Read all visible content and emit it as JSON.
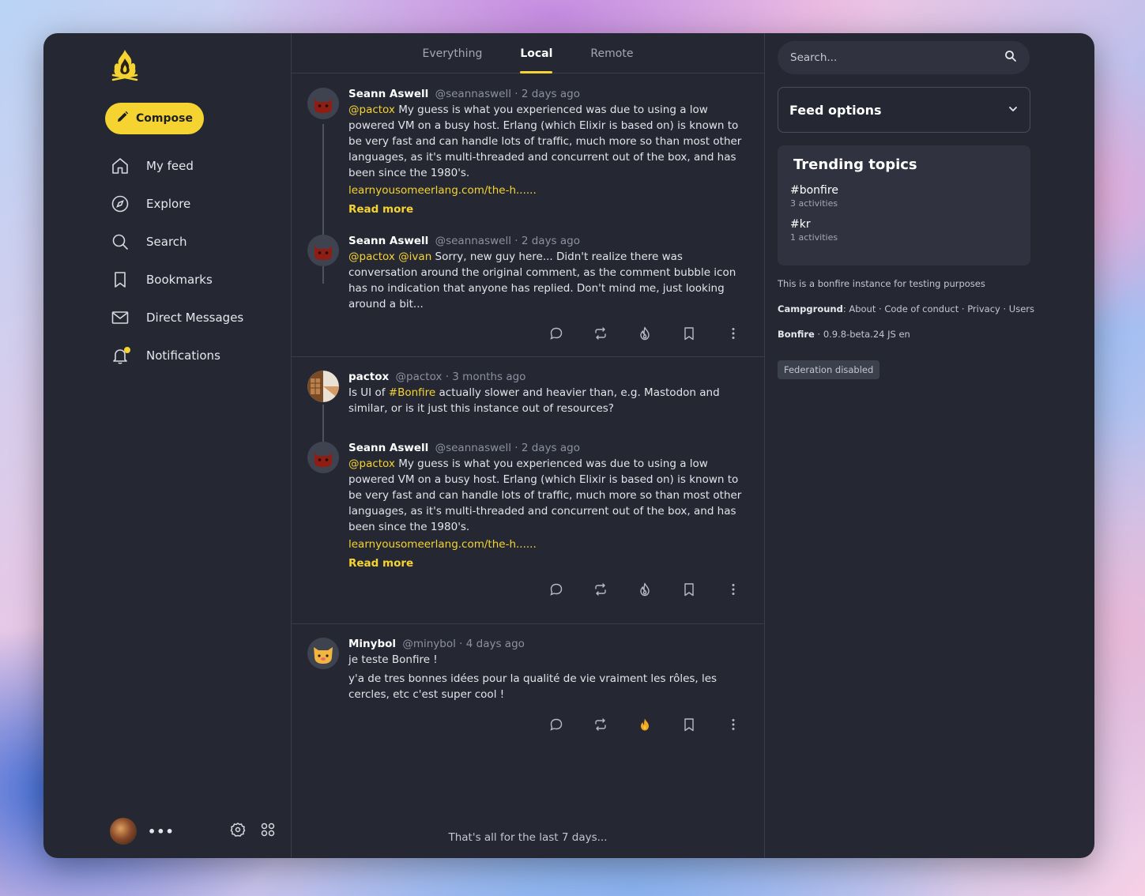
{
  "sidebar": {
    "compose_label": "Compose",
    "nav": [
      {
        "label": "My feed",
        "icon": "home-icon"
      },
      {
        "label": "Explore",
        "icon": "compass-icon"
      },
      {
        "label": "Search",
        "icon": "search-icon"
      },
      {
        "label": "Bookmarks",
        "icon": "bookmark-icon"
      },
      {
        "label": "Direct Messages",
        "icon": "envelope-icon"
      },
      {
        "label": "Notifications",
        "icon": "bell-icon"
      }
    ],
    "more_label": "•••"
  },
  "tabs": [
    {
      "label": "Everything",
      "active": false
    },
    {
      "label": "Local",
      "active": true
    },
    {
      "label": "Remote",
      "active": false
    }
  ],
  "feed": {
    "thread1": {
      "post1": {
        "name": "Seann Aswell",
        "handle": "@seannaswell",
        "time": "· 2 days ago",
        "mention": "@pactox",
        "text": " My guess is what you experienced was due to using a low powered VM on a busy host. Erlang (which Elixir is based on) is known to be very fast and can handle lots of traffic, much more so than most other languages, as it's multi-threaded and concurrent out of the box, and has been since the 1980's.",
        "link": "learnyousomeerlang.com/the-h......",
        "read_more": "Read more"
      },
      "post2": {
        "name": "Seann Aswell",
        "handle": "@seannaswell",
        "time": "· 2 days ago",
        "mention": "@pactox @ivan",
        "text": "  Sorry, new guy here... Didn't realize there was conversation around the original comment, as the comment bubble icon has no indication that anyone has replied. Don't mind me, just looking around a bit..."
      }
    },
    "thread2": {
      "post1": {
        "name": "pactox",
        "handle": "@pactox",
        "time": "· 3 months ago",
        "text_before": "Is UI of ",
        "hashtag": "#Bonfire",
        "text_after": " actually slower and heavier than, e.g. Mastodon and similar, or is it just this instance out of resources?"
      },
      "post2": {
        "name": "Seann Aswell",
        "handle": "@seannaswell",
        "time": "· 2 days ago",
        "mention": "@pactox",
        "text": " My guess is what you experienced was due to using a low powered VM on a busy host. Erlang (which Elixir is based on) is known to be very fast and can handle lots of traffic, much more so than most other languages, as it's multi-threaded and concurrent out of the box, and has been since the 1980's.",
        "link": "learnyousomeerlang.com/the-h......",
        "read_more": "Read more"
      }
    },
    "thread3": {
      "post1": {
        "name": "Minybol",
        "handle": "@minybol",
        "time": "· 4 days ago",
        "line1": "je teste Bonfire !",
        "line2": "y'a de tres bonnes idées pour la qualité de vie vraiment les rôles, les cercles, etc c'est super cool !",
        "liked": true
      }
    },
    "end_text": "That's all for the last 7 days..."
  },
  "right": {
    "search_placeholder": "Search...",
    "feed_options": "Feed options",
    "trending_title": "Trending topics",
    "topics": [
      {
        "tag": "#bonfire",
        "count": "3 activities"
      },
      {
        "tag": "#kr",
        "count": "1 activities"
      }
    ],
    "instance_desc": "This is a bonfire instance for testing purposes",
    "campground_label": "Campground",
    "campground_links": ": About · Code of conduct · Privacy · Users",
    "bonfire_label": "Bonfire",
    "version": " · 0.9.8-beta.24  JS  en",
    "federation_badge": "Federation disabled"
  },
  "colors": {
    "accent": "#f5d431",
    "panel": "#252833",
    "card": "#30333f",
    "border": "#3a3e4a"
  }
}
